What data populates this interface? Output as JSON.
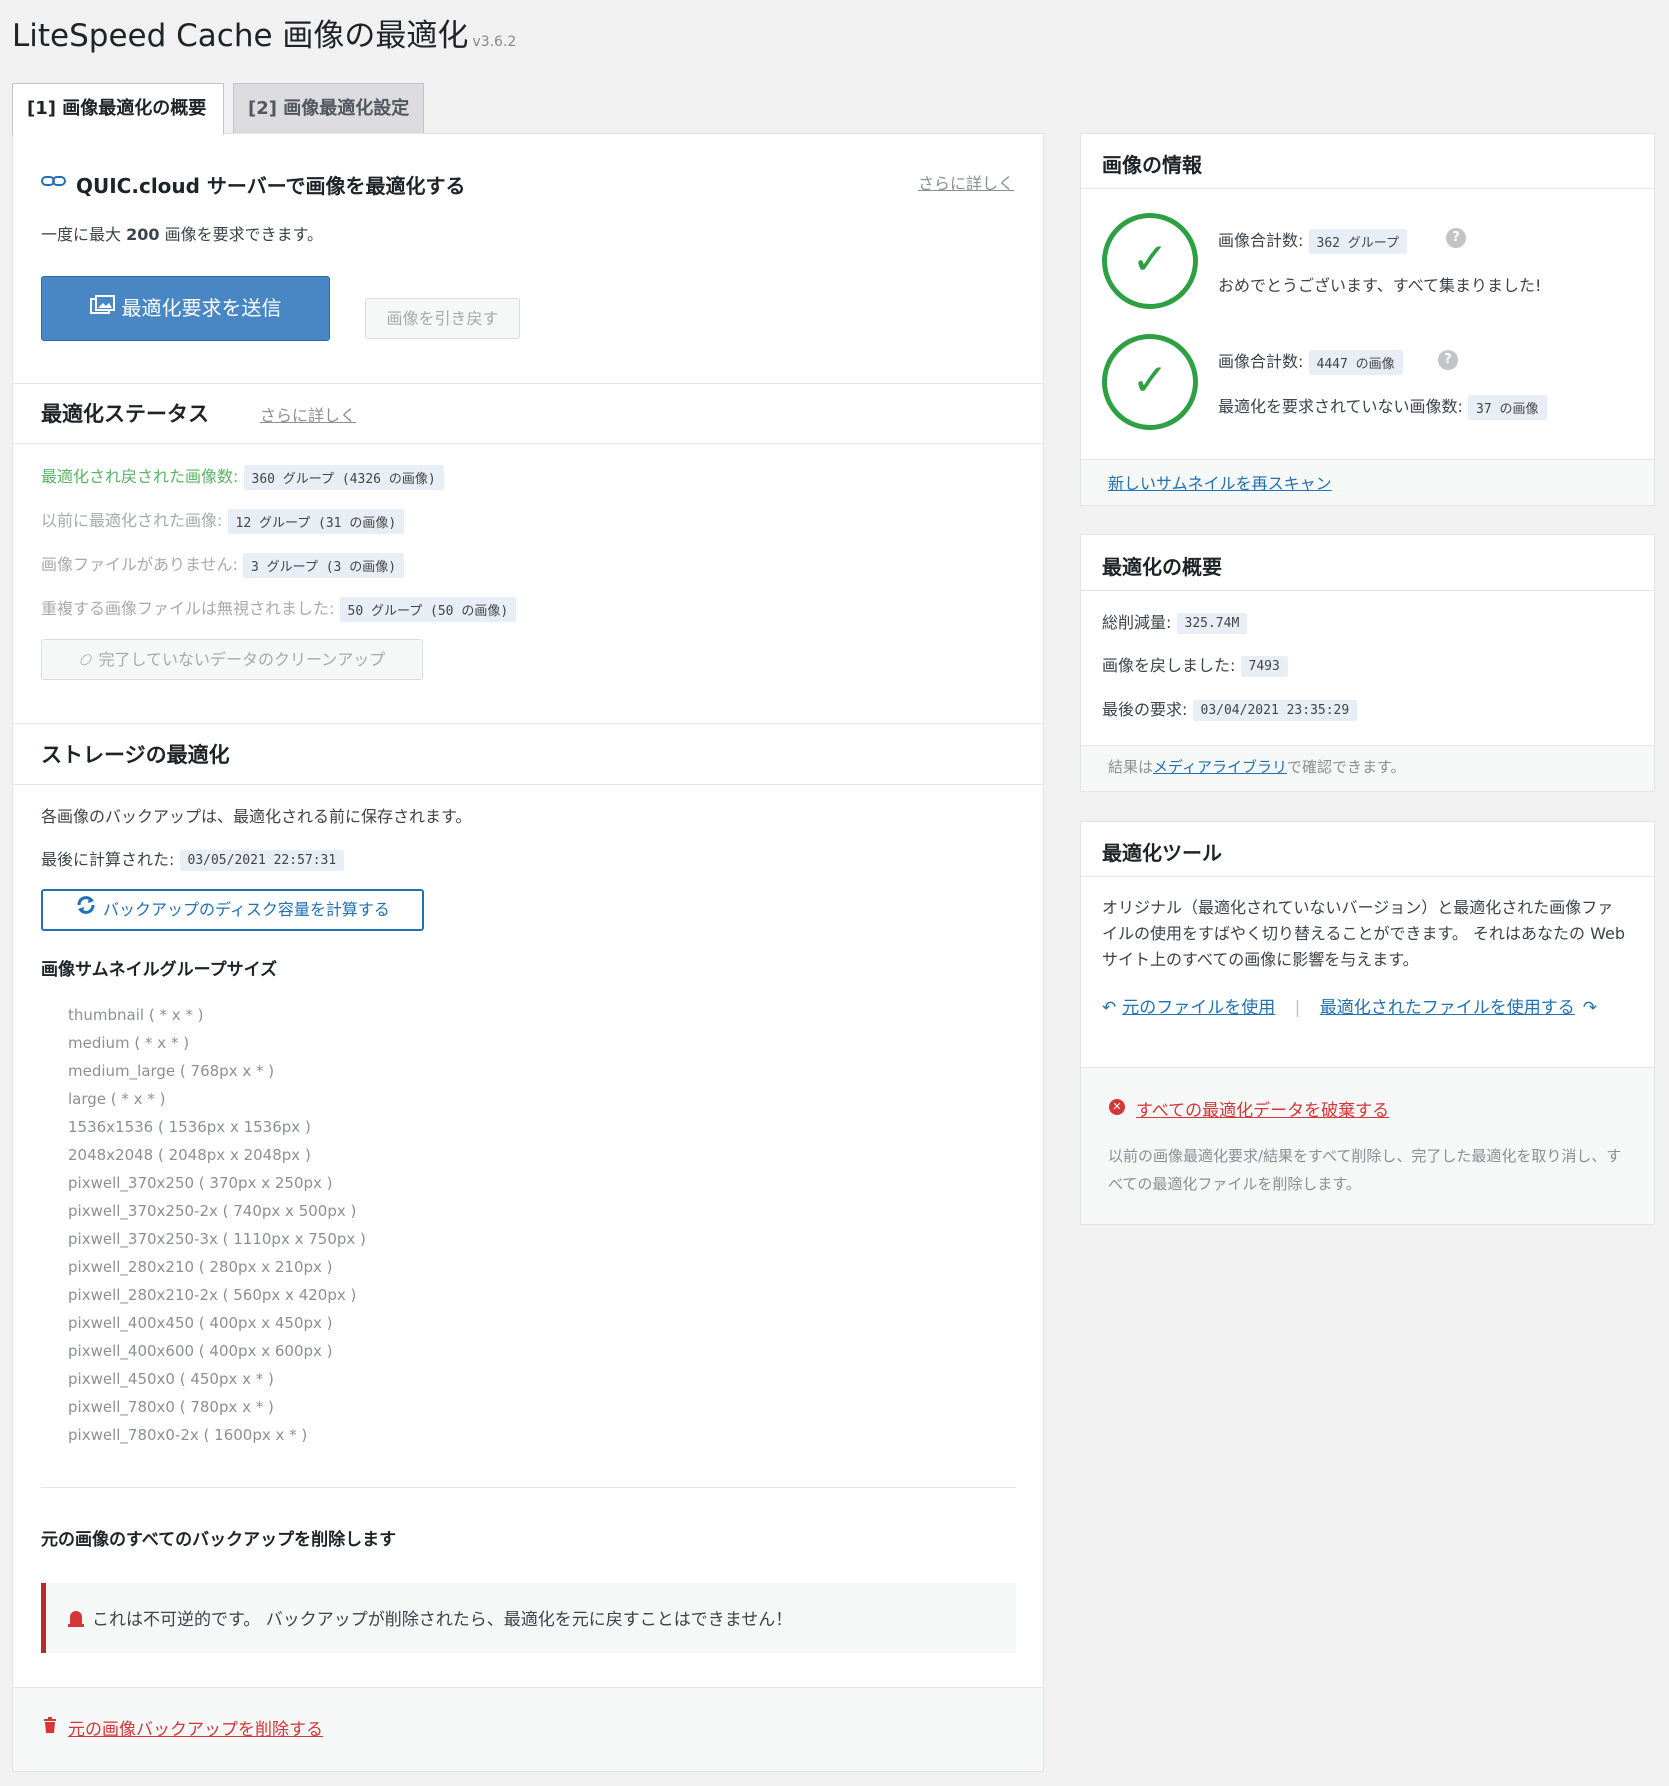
{
  "header": {
    "title": "LiteSpeed Cache 画像の最適化",
    "version": "v3.6.2"
  },
  "tabs": [
    {
      "label": "[1] 画像最適化の概要",
      "active": true
    },
    {
      "label": "[2] 画像最適化設定",
      "active": false
    }
  ],
  "quic": {
    "heading": "QUIC.cloud サーバーで画像を最適化する",
    "learn_more": "さらに詳しく",
    "desc_prefix": "一度に最大",
    "desc_count": "200",
    "desc_suffix": "画像を要求できます。",
    "send_button": "最適化要求を送信",
    "pull_button": "画像を引き戻す"
  },
  "status": {
    "heading": "最適化ステータス",
    "learn_more": "さらに詳しく",
    "rows": [
      {
        "label": "最適化され戻された画像数:",
        "value": "360 グループ (4326 の画像)"
      },
      {
        "label": "以前に最適化された画像:",
        "value": "12 グループ (31 の画像)"
      },
      {
        "label": "画像ファイルがありません:",
        "value": "3 グループ (3 の画像)"
      },
      {
        "label": "重複する画像ファイルは無視されました:",
        "value": "50 グループ (50 の画像)"
      }
    ],
    "cleanup_button": "完了していないデータのクリーンアップ"
  },
  "storage": {
    "heading": "ストレージの最適化",
    "desc": "各画像のバックアップは、最適化される前に保存されます。",
    "last_calc_label": "最後に計算された:",
    "last_calc_value": "03/05/2021 22:57:31",
    "calc_button": "バックアップのディスク容量を計算する",
    "thumb_heading": "画像サムネイルグループサイズ",
    "sizes": [
      "thumbnail ( * x * )",
      "medium ( * x * )",
      "medium_large ( 768px x * )",
      "large ( * x * )",
      "1536x1536 ( 1536px x 1536px )",
      "2048x2048 ( 2048px x 2048px )",
      "pixwell_370x250 ( 370px x 250px )",
      "pixwell_370x250-2x ( 740px x 500px )",
      "pixwell_370x250-3x ( 1110px x 750px )",
      "pixwell_280x210 ( 280px x 210px )",
      "pixwell_280x210-2x ( 560px x 420px )",
      "pixwell_400x450 ( 400px x 450px )",
      "pixwell_400x600 ( 400px x 600px )",
      "pixwell_450x0 ( 450px x * )",
      "pixwell_780x0 ( 780px x * )",
      "pixwell_780x0-2x ( 1600px x * )"
    ],
    "delete_heading": "元の画像のすべてのバックアップを削除します",
    "warning": "これは不可逆的です。 バックアップが削除されたら、最適化を元に戻すことはできません！",
    "delete_link": "元の画像バックアップを削除する"
  },
  "image_info": {
    "heading": "画像の情報",
    "total_label": "画像合計数:",
    "groups_value": "362 グループ",
    "congrats": "おめでとうございます、すべて集まりました!",
    "images_value": "4447 の画像",
    "not_requested_label": "最適化を要求されていない画像数:",
    "not_requested_value": "37 の画像",
    "rescan_link": "新しいサムネイルを再スキャン"
  },
  "summary": {
    "heading": "最適化の概要",
    "reduction_label": "総削減量:",
    "reduction_value": "325.74M",
    "restored_label": "画像を戻しました:",
    "restored_value": "7493",
    "last_request_label": "最後の要求:",
    "last_request_value": "03/04/2021 23:35:29",
    "footer_prefix": "結果は",
    "footer_link": "メディアライブラリ",
    "footer_suffix": "で確認できます。"
  },
  "tools": {
    "heading": "最適化ツール",
    "desc": "オリジナル（最適化されていないバージョン）と最適化された画像ファイルの使用をすばやく切り替えることができます。 それはあなたの Web サイト上のすべての画像に影響を与えます。",
    "use_original": "元のファイルを使用",
    "use_optimized": "最適化されたファイルを使用する",
    "destroy_link": "すべての最適化データを破棄する",
    "destroy_desc": "以前の画像最適化要求/結果をすべて削除し、完了した最適化を取り消し、すべての最適化ファイルを削除します。"
  }
}
